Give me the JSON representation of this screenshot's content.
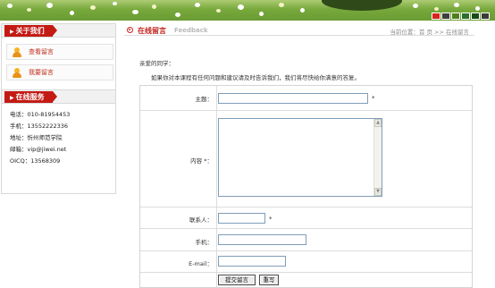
{
  "theme": {
    "swatches": [
      "#d9231c",
      "#3e3e3e",
      "#4e7e1f",
      "#2f6c2f",
      "#1a4a1a",
      "#3a3a3a"
    ]
  },
  "sidebar": {
    "about": {
      "title": "关于我们",
      "items": [
        {
          "label": "查看留言"
        },
        {
          "label": "我要留言"
        }
      ]
    },
    "service": {
      "title": "在线服务",
      "rows": [
        "电话：010-81954453",
        "手机：13552222336",
        "地址：忻州师范学院",
        "邮箱：vip@jiwei.net",
        "OICQ：13568309"
      ]
    }
  },
  "main": {
    "title": "在线留言",
    "subtitle": "Feedback",
    "breadcrumb": "当前位置：首 页 >> 在线留言",
    "greeting": "亲爱的同学：",
    "intro": "如果你对本课程有任何问题和建议请及时告诉我们，我们将尽快给你满意的答复。"
  },
  "form": {
    "subject_label": "主题：",
    "content_label": "内容 *：",
    "contact_label": "联系人：",
    "mobile_label": "手机：",
    "email_label": "E-mail：",
    "required_mark": "*",
    "subject_value": "",
    "contact_value": "",
    "mobile_value": "",
    "email_value": "",
    "submit_label": "提交留言",
    "reset_label": "重写",
    "scroll_up": "▲",
    "scroll_down": "▼"
  }
}
